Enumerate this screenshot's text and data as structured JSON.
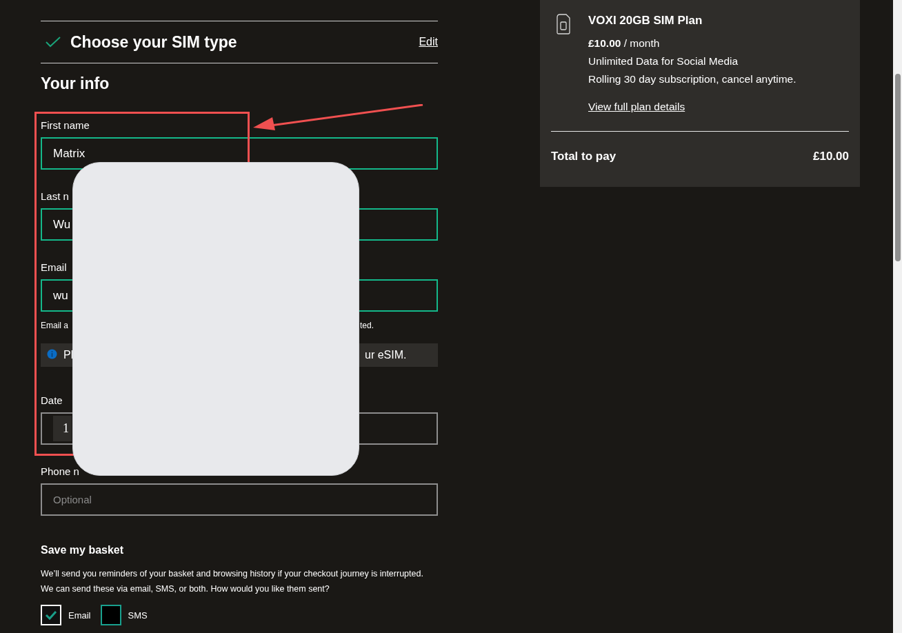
{
  "step": {
    "title": "Choose your SIM type",
    "completed": true,
    "edit_link": "Edit"
  },
  "section_title": "Your info",
  "fields": [
    {
      "kind": "text",
      "label": "First name",
      "value": "Matrix",
      "valid": true
    },
    {
      "kind": "text",
      "label": "Last n",
      "value": "Wu",
      "valid": true
    },
    {
      "kind": "text",
      "label": "Email",
      "value": "wu",
      "valid": true,
      "hint": [
        "Email a",
        "ted."
      ],
      "info": [
        "Pl",
        "ur eSIM."
      ]
    },
    {
      "kind": "date",
      "label": "Date",
      "value": "1",
      "valid": false
    },
    {
      "kind": "text",
      "label": "Phone n",
      "placeholder": "Optional",
      "valid": false
    }
  ],
  "basket": {
    "title": "Save my basket",
    "text": "We’ll send you reminders of your basket and browsing history if your checkout journey is interrupted. We can send these via email, SMS, or both. How would you like them sent?",
    "options": [
      {
        "label": "Email",
        "checked": true
      },
      {
        "label": "SMS",
        "checked": false
      }
    ]
  },
  "summary": {
    "plan": "VOXI 20GB SIM Plan",
    "price": "**£10.00** / month",
    "features": [
      "Unlimited Data for Social Media",
      "Rolling 30 day subscription, cancel anytime."
    ],
    "link": "View full plan details",
    "total_label": "Total to pay",
    "total": "£10.00"
  }
}
